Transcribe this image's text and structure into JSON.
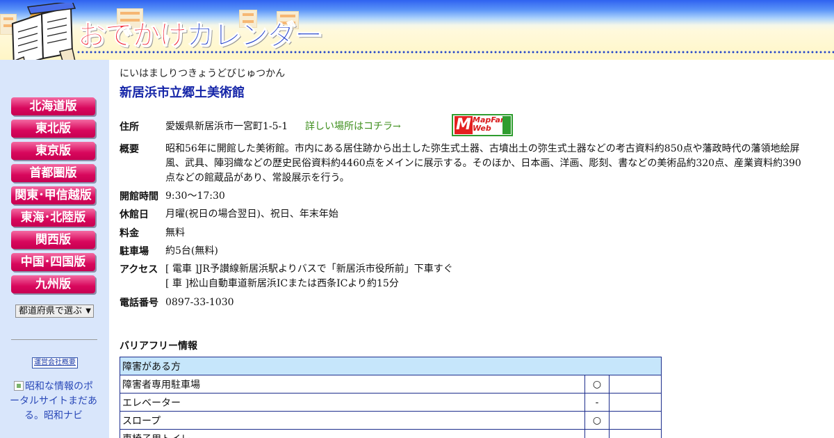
{
  "header": {
    "logo_text_red": "おでかけ",
    "logo_text_blue": "カレンダー"
  },
  "sidebar": {
    "editions": [
      {
        "label": "北海道版"
      },
      {
        "label": "東北版"
      },
      {
        "label": "東京版"
      },
      {
        "label": "首都圏版"
      },
      {
        "label": "関東･甲信越版"
      },
      {
        "label": "東海･北陸版"
      },
      {
        "label": "関西版"
      },
      {
        "label": "中国･四国版"
      },
      {
        "label": "九州版"
      }
    ],
    "pref_select": "都道府県で選ぶ",
    "company_link": "運営会社概要",
    "banner_alt": "昭和な情報のポータルサイトまだある。昭和ナビ"
  },
  "facility": {
    "kana": "にいはましりつきょうどびじゅつかん",
    "name": "新居浜市立郷土美術館"
  },
  "info": {
    "address_label": "住所",
    "address": "愛媛県新居浜市一宮町1-5-1",
    "detail_link": "詳しい場所はコチラ→",
    "mapfan_logo": "MapFan Web",
    "overview_label": "概要",
    "overview": "昭和56年に開館した美術館。市内にある居住跡から出土した弥生式土器、古墳出土の弥生式土器などの考古資料約850点や藩政時代の藩領地絵屏風、武具、陣羽織などの歴史民俗資料約4460点をメインに展示する。そのほか、日本画、洋画、彫刻、書などの美術品約320点、産業資料約390点などの館蔵品があり、常設展示を行う。",
    "hours_label": "開館時間",
    "hours": "9:30～17:30",
    "closed_label": "休館日",
    "closed": "月曜(祝日の場合翌日)、祝日、年末年始",
    "fee_label": "料金",
    "fee": "無料",
    "parking_label": "駐車場",
    "parking": "約5台(無料)",
    "access_label": "アクセス",
    "access_train": "[ 電車 ]JR予讃線新居浜駅よりバスで「新居浜市役所前」下車すぐ",
    "access_car": "[ 車 ]松山自動車道新居浜ICまたは西条ICより約15分",
    "phone_label": "電話番号",
    "phone": "0897-33-1030"
  },
  "barrier_free": {
    "title": "バリアフリー情報",
    "section_header": "障害がある方",
    "rows": [
      {
        "item": "障害者専用駐車場",
        "mark": "○",
        "note": ""
      },
      {
        "item": "エレベーター",
        "mark": "-",
        "note": ""
      },
      {
        "item": "スロープ",
        "mark": "○",
        "note": ""
      },
      {
        "item": "車椅子用トイレ",
        "mark": "",
        "note": ""
      }
    ]
  }
}
